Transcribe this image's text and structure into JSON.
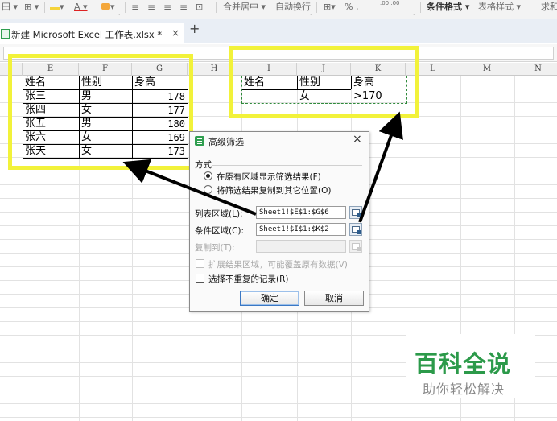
{
  "ribbon": {
    "items": [
      "田 ▾",
      "⊞ ▾",
      "▾",
      "A ▾",
      "▾",
      "合并居中 ▾",
      "自动换行",
      "% ,",
      "条件格式 ▾",
      "表格样式 ▾",
      "求和"
    ],
    "merge_center": "合并居中 ▾",
    "wrap": "自动换行",
    "percent": "% ,",
    "decimals": ".00 .00",
    "cond_format": "条件格式 ▾",
    "table_style": "表格样式 ▾",
    "sum": "求和"
  },
  "tab": {
    "title": "新建 Microsoft Excel 工作表.xlsx *",
    "close": "×",
    "new": "+"
  },
  "columns": [
    "E",
    "F",
    "G",
    "H",
    "I",
    "J",
    "K",
    "L",
    "M",
    "N"
  ],
  "list_table": {
    "headers": [
      "姓名",
      "性别",
      "身高"
    ],
    "rows": [
      [
        "张三",
        "男",
        "178"
      ],
      [
        "张四",
        "女",
        "177"
      ],
      [
        "张五",
        "男",
        "180"
      ],
      [
        "张六",
        "女",
        "169"
      ],
      [
        "张天",
        "女",
        "173"
      ]
    ]
  },
  "criteria_table": {
    "headers": [
      "姓名",
      "性别",
      "身高"
    ],
    "row": [
      "",
      "女",
      ">170"
    ]
  },
  "dialog": {
    "title": "高级筛选",
    "close": "×",
    "mode_label": "方式",
    "option_in_place": "在原有区域显示筛选结果(F)",
    "option_copy": "将筛选结果复制到其它位置(O)",
    "list_range_label": "列表区域(L):",
    "list_range_value": "Sheet1!$E$1:$G$6",
    "criteria_range_label": "条件区域(C):",
    "criteria_range_value": "Sheet1!$I$1:$K$2",
    "copy_to_label": "复制到(T):",
    "copy_to_value": "",
    "expand_label": "扩展结果区域，可能覆盖原有数据(V)",
    "unique_label": "选择不重复的记录(R)",
    "ok": "确定",
    "cancel": "取消"
  },
  "watermark": {
    "title": "百科全说",
    "subtitle": "助你轻松解决"
  },
  "colors": {
    "highlight": "#f2f23a",
    "criteria_dash": "#2f8a3b",
    "brand_green": "#2c9a4a"
  }
}
